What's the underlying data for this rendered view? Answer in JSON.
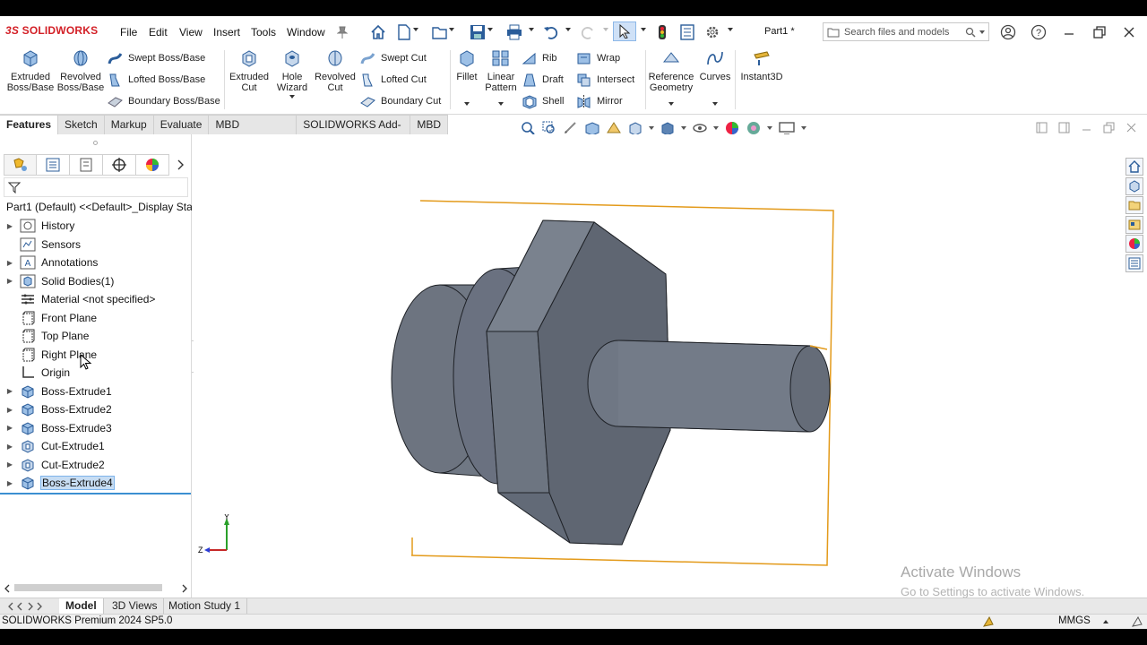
{
  "app": {
    "logo_text": "SOLIDWORKS",
    "document_title": "Part1 *",
    "brand_color": "#d31f26"
  },
  "menu": [
    "File",
    "Edit",
    "View",
    "Insert",
    "Tools",
    "Window"
  ],
  "search": {
    "placeholder": "Search files and models"
  },
  "ribbon": {
    "extruded_boss": "Extruded Boss/Base",
    "revolved_boss": "Revolved Boss/Base",
    "swept_boss": "Swept Boss/Base",
    "lofted_boss": "Lofted Boss/Base",
    "boundary_boss": "Boundary Boss/Base",
    "extruded_cut": "Extruded Cut",
    "hole_wizard": "Hole Wizard",
    "revolved_cut": "Revolved Cut",
    "swept_cut": "Swept Cut",
    "lofted_cut": "Lofted Cut",
    "boundary_cut": "Boundary Cut",
    "fillet": "Fillet",
    "linear_pattern": "Linear Pattern",
    "rib": "Rib",
    "draft": "Draft",
    "shell": "Shell",
    "wrap": "Wrap",
    "intersect": "Intersect",
    "mirror": "Mirror",
    "reference_geometry": "Reference Geometry",
    "curves": "Curves",
    "instant3d": "Instant3D"
  },
  "tabs": [
    "Features",
    "Sketch",
    "Markup",
    "Evaluate",
    "MBD Dimensions",
    "SOLIDWORKS Add-Ins",
    "MBD"
  ],
  "active_tab": "Features",
  "tree": {
    "root": "Part1 (Default) <<Default>_Display Sta",
    "nodes": [
      {
        "label": "History",
        "expandable": true
      },
      {
        "label": "Sensors",
        "expandable": false
      },
      {
        "label": "Annotations",
        "expandable": true
      },
      {
        "label": "Solid Bodies(1)",
        "expandable": true
      },
      {
        "label": "Material <not specified>",
        "expandable": false
      },
      {
        "label": "Front Plane",
        "expandable": false
      },
      {
        "label": "Top Plane",
        "expandable": false
      },
      {
        "label": "Right Plane",
        "expandable": false
      },
      {
        "label": "Origin",
        "expandable": false
      },
      {
        "label": "Boss-Extrude1",
        "expandable": true
      },
      {
        "label": "Boss-Extrude2",
        "expandable": true
      },
      {
        "label": "Boss-Extrude3",
        "expandable": true
      },
      {
        "label": "Cut-Extrude1",
        "expandable": true
      },
      {
        "label": "Cut-Extrude2",
        "expandable": true
      },
      {
        "label": "Boss-Extrude4",
        "expandable": true,
        "selected": true
      }
    ]
  },
  "triad": {
    "y_label": "Y",
    "z_label": "Z"
  },
  "watermark": {
    "line1": "Activate Windows",
    "line2": "Go to Settings to activate Windows."
  },
  "bottom_tabs": [
    "Model",
    "3D Views",
    "Motion Study 1"
  ],
  "status": {
    "product": "SOLIDWORKS Premium 2024 SP5.0",
    "units": "MMGS"
  },
  "colors": {
    "part_face": "#6b7380",
    "selection_box": "#e39a1a",
    "tree_selected": "#c7ddf3"
  }
}
